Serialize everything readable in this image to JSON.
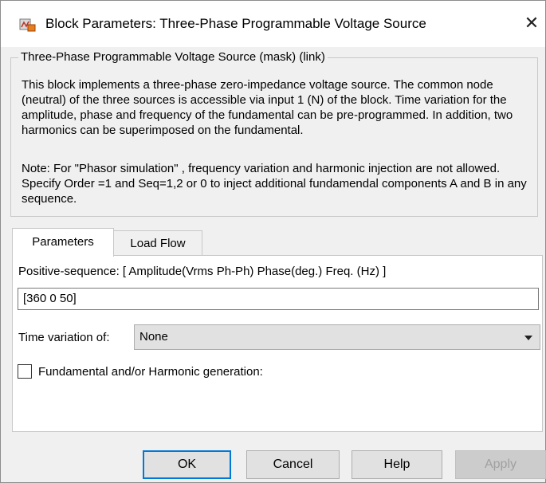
{
  "window": {
    "title": "Block Parameters: Three-Phase Programmable Voltage Source",
    "close_glyph": "✕"
  },
  "mask": {
    "legend": "Three-Phase Programmable Voltage Source (mask) (link)",
    "description": "This block implements a three-phase zero-impedance voltage source. The common node (neutral) of the three sources is accessible via input 1 (N) of the block. Time variation for the amplitude, phase and frequency of the fundamental can be pre-programmed. In addition, two harmonics can be superimposed on the fundamental.",
    "note": "Note: For  \"Phasor simulation\" , frequency variation and harmonic injection are not allowed.  Specify  Order =1 and Seq=1,2 or 0 to inject additional fundamendal components A and B in  any sequence."
  },
  "tabs": [
    {
      "label": "Parameters",
      "active": true
    },
    {
      "label": "Load Flow",
      "active": false
    }
  ],
  "parameters": {
    "positive_sequence_label": "Positive-sequence: [ Amplitude(Vrms Ph-Ph)  Phase(deg.)   Freq. (Hz) ]",
    "positive_sequence_value": "[360  0 50]",
    "time_variation_label": "Time variation of:",
    "time_variation_value": "None",
    "harmonic_checkbox_label": "Fundamental and/or Harmonic generation:",
    "harmonic_checked": false
  },
  "buttons": {
    "ok": "OK",
    "cancel": "Cancel",
    "help": "Help",
    "apply": "Apply"
  },
  "icons": [
    "simulink-block-icon",
    "close-icon",
    "chevron-down-icon"
  ]
}
